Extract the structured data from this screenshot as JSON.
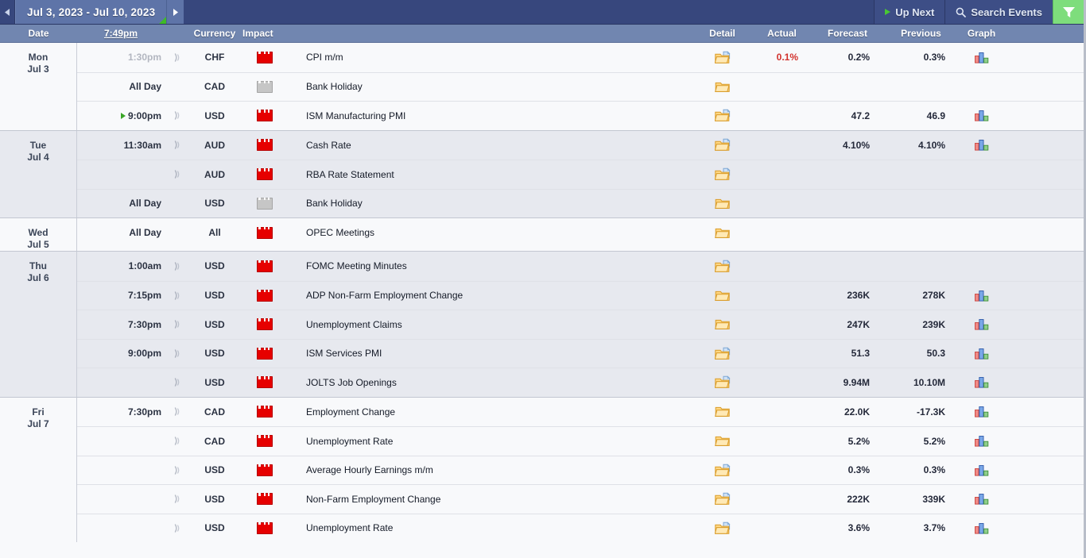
{
  "titlebar": {
    "prev_label": "◀",
    "date_range": "Jul 3, 2023 - Jul 10, 2023",
    "next_label": "▶",
    "up_next_label": "Up Next",
    "search_label": "Search Events",
    "filter_label": "",
    "colors": {
      "bar_bg": "#37477d",
      "date_btn_bg": "#5e74a8",
      "accent_green": "#7edd7c",
      "corner_green": "#3fbb27"
    }
  },
  "columns": [
    {
      "key": "date",
      "label": "Date",
      "align": "center"
    },
    {
      "key": "time",
      "label": "7:49pm",
      "align": "center",
      "underline": true
    },
    {
      "key": "sound",
      "label": "",
      "align": "center"
    },
    {
      "key": "currency",
      "label": "Currency",
      "align": "center"
    },
    {
      "key": "impact",
      "label": "Impact",
      "align": "left"
    },
    {
      "key": "title",
      "label": "",
      "align": "left"
    },
    {
      "key": "detail",
      "label": "Detail",
      "align": "center"
    },
    {
      "key": "actual",
      "label": "Actual",
      "align": "center"
    },
    {
      "key": "forecast",
      "label": "Forecast",
      "align": "center"
    },
    {
      "key": "previous",
      "label": "Previous",
      "align": "center"
    },
    {
      "key": "graph",
      "label": "Graph",
      "align": "center"
    }
  ],
  "days": [
    {
      "day": "Mon",
      "date": "Jul 3",
      "shade": "a",
      "events": [
        {
          "time": "1:30pm",
          "time_muted": true,
          "up_next": false,
          "sound": true,
          "currency": "CHF",
          "impact": "high",
          "title": "CPI m/m",
          "detail_icon": "folder-doc-icon",
          "actual": "0.1%",
          "actual_state": "worse",
          "forecast": "0.2%",
          "previous": "0.3%",
          "graph": true
        },
        {
          "time": "All Day",
          "time_muted": false,
          "up_next": false,
          "sound": false,
          "currency": "CAD",
          "impact": "holiday",
          "title": "Bank Holiday",
          "detail_icon": "folder-icon",
          "actual": "",
          "actual_state": "",
          "forecast": "",
          "previous": "",
          "graph": false
        },
        {
          "time": "9:00pm",
          "time_muted": false,
          "up_next": true,
          "sound": true,
          "currency": "USD",
          "impact": "high",
          "title": "ISM Manufacturing PMI",
          "detail_icon": "folder-doc-icon",
          "actual": "",
          "actual_state": "",
          "forecast": "47.2",
          "previous": "46.9",
          "graph": true
        }
      ]
    },
    {
      "day": "Tue",
      "date": "Jul 4",
      "shade": "b",
      "events": [
        {
          "time": "11:30am",
          "time_muted": false,
          "up_next": false,
          "sound": true,
          "currency": "AUD",
          "impact": "high",
          "title": "Cash Rate",
          "detail_icon": "folder-doc-icon",
          "actual": "",
          "actual_state": "",
          "forecast": "4.10%",
          "previous": "4.10%",
          "graph": true
        },
        {
          "time": "",
          "time_muted": false,
          "up_next": false,
          "sound": true,
          "currency": "AUD",
          "impact": "high",
          "title": "RBA Rate Statement",
          "detail_icon": "folder-doc-icon",
          "actual": "",
          "actual_state": "",
          "forecast": "",
          "previous": "",
          "graph": false
        },
        {
          "time": "All Day",
          "time_muted": false,
          "up_next": false,
          "sound": false,
          "currency": "USD",
          "impact": "holiday",
          "title": "Bank Holiday",
          "detail_icon": "folder-icon",
          "actual": "",
          "actual_state": "",
          "forecast": "",
          "previous": "",
          "graph": false
        }
      ]
    },
    {
      "day": "Wed",
      "date": "Jul 5",
      "shade": "a",
      "events": [
        {
          "time": "All Day",
          "time_muted": false,
          "up_next": false,
          "sound": false,
          "currency": "All",
          "impact": "high",
          "title": "OPEC Meetings",
          "detail_icon": "folder-icon",
          "actual": "",
          "actual_state": "",
          "forecast": "",
          "previous": "",
          "graph": false
        }
      ]
    },
    {
      "day": "Thu",
      "date": "Jul 6",
      "shade": "b",
      "events": [
        {
          "time": "1:00am",
          "time_muted": false,
          "up_next": false,
          "sound": true,
          "currency": "USD",
          "impact": "high",
          "title": "FOMC Meeting Minutes",
          "detail_icon": "folder-doc-icon",
          "actual": "",
          "actual_state": "",
          "forecast": "",
          "previous": "",
          "graph": false
        },
        {
          "time": "7:15pm",
          "time_muted": false,
          "up_next": false,
          "sound": true,
          "currency": "USD",
          "impact": "high",
          "title": "ADP Non-Farm Employment Change",
          "detail_icon": "folder-icon",
          "actual": "",
          "actual_state": "",
          "forecast": "236K",
          "previous": "278K",
          "graph": true
        },
        {
          "time": "7:30pm",
          "time_muted": false,
          "up_next": false,
          "sound": true,
          "currency": "USD",
          "impact": "high",
          "title": "Unemployment Claims",
          "detail_icon": "folder-icon",
          "actual": "",
          "actual_state": "",
          "forecast": "247K",
          "previous": "239K",
          "graph": true
        },
        {
          "time": "9:00pm",
          "time_muted": false,
          "up_next": false,
          "sound": true,
          "currency": "USD",
          "impact": "high",
          "title": "ISM Services PMI",
          "detail_icon": "folder-doc-icon",
          "actual": "",
          "actual_state": "",
          "forecast": "51.3",
          "previous": "50.3",
          "graph": true
        },
        {
          "time": "",
          "time_muted": false,
          "up_next": false,
          "sound": true,
          "currency": "USD",
          "impact": "high",
          "title": "JOLTS Job Openings",
          "detail_icon": "folder-doc-icon",
          "actual": "",
          "actual_state": "",
          "forecast": "9.94M",
          "previous": "10.10M",
          "graph": true
        }
      ]
    },
    {
      "day": "Fri",
      "date": "Jul 7",
      "shade": "a",
      "events": [
        {
          "time": "7:30pm",
          "time_muted": false,
          "up_next": false,
          "sound": true,
          "currency": "CAD",
          "impact": "high",
          "title": "Employment Change",
          "detail_icon": "folder-icon",
          "actual": "",
          "actual_state": "",
          "forecast": "22.0K",
          "previous": "-17.3K",
          "graph": true
        },
        {
          "time": "",
          "time_muted": false,
          "up_next": false,
          "sound": true,
          "currency": "CAD",
          "impact": "high",
          "title": "Unemployment Rate",
          "detail_icon": "folder-icon",
          "actual": "",
          "actual_state": "",
          "forecast": "5.2%",
          "previous": "5.2%",
          "graph": true
        },
        {
          "time": "",
          "time_muted": false,
          "up_next": false,
          "sound": true,
          "currency": "USD",
          "impact": "high",
          "title": "Average Hourly Earnings m/m",
          "detail_icon": "folder-doc-icon",
          "actual": "",
          "actual_state": "",
          "forecast": "0.3%",
          "previous": "0.3%",
          "graph": true
        },
        {
          "time": "",
          "time_muted": false,
          "up_next": false,
          "sound": true,
          "currency": "USD",
          "impact": "high",
          "title": "Non-Farm Employment Change",
          "detail_icon": "folder-doc-icon",
          "actual": "",
          "actual_state": "",
          "forecast": "222K",
          "previous": "339K",
          "graph": true
        },
        {
          "time": "",
          "time_muted": false,
          "up_next": false,
          "sound": true,
          "currency": "USD",
          "impact": "high",
          "title": "Unemployment Rate",
          "detail_icon": "folder-doc-icon",
          "actual": "",
          "actual_state": "",
          "forecast": "3.6%",
          "previous": "3.7%",
          "graph": true
        }
      ]
    }
  ]
}
